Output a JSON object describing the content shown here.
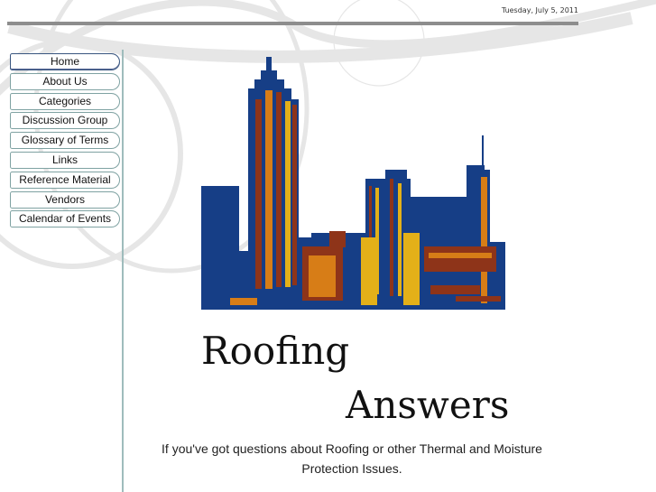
{
  "header": {
    "date": "Tuesday, July 5, 2011"
  },
  "nav": {
    "items": [
      {
        "label": "Home",
        "active": true
      },
      {
        "label": "About Us"
      },
      {
        "label": "Categories"
      },
      {
        "label": "Discussion Group"
      },
      {
        "label": "Glossary of Terms"
      },
      {
        "label": "Links"
      },
      {
        "label": "Reference Material"
      },
      {
        "label": "Vendors"
      },
      {
        "label": "Calendar of Events"
      }
    ]
  },
  "logo": {
    "line1": "Roofing",
    "line2": "Answers"
  },
  "main": {
    "tagline_1": "If you've got questions about Roofing or other Thermal and Moisture",
    "tagline_2": "Protection Issues."
  },
  "colors": {
    "navy": "#163e86",
    "rust": "#8e3419",
    "gold": "#e3b019",
    "orange": "#d77d17",
    "rule": "#8d8d8d"
  }
}
